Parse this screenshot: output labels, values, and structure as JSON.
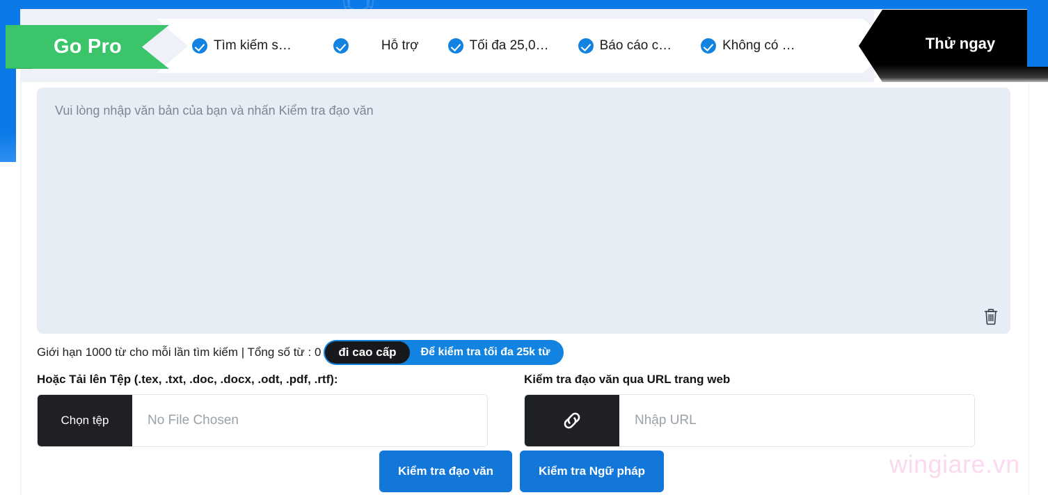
{
  "banner": {
    "gopro_label": "Go Pro",
    "cta_label": "Thử ngay",
    "features": [
      {
        "label": "Tìm kiếm s…",
        "icon": "check-circle-icon"
      },
      {
        "label": "Hỗ trợ",
        "icon": "check-circle-icon"
      },
      {
        "label": "Tối đa 25,0…",
        "icon": "check-circle-icon"
      },
      {
        "label": "Báo cáo c…",
        "icon": "check-circle-icon"
      },
      {
        "label": "Không có …",
        "icon": "check-circle-icon"
      }
    ],
    "colors": {
      "band": "#0b7ae8",
      "gopro": "#3cc46b",
      "cta": "#000000",
      "check": "#1283e0"
    }
  },
  "editor": {
    "placeholder": "Vui lòng nhập văn bản của bạn và nhấn Kiểm tra đạo văn",
    "value": "",
    "clear_icon": "trash-icon",
    "background": "#e7edf5"
  },
  "counter": {
    "text": "Giới hạn 1000 từ cho mỗi lần tìm kiếm | Tổng số từ : 0",
    "premium_badge": "đi cao cấp",
    "premium_text": "Để kiểm tra tối đa 25k từ",
    "badge_color": "#1283e0"
  },
  "upload": {
    "label": "Hoặc Tải lên Tệp (.tex, .txt, .doc, .docx, .odt, .pdf, .rtf):",
    "button_label": "Chọn tệp",
    "file_placeholder": "No File Chosen",
    "file_value": ""
  },
  "url": {
    "label": "Kiểm tra đạo văn qua URL trang web",
    "icon": "link-icon",
    "placeholder": "Nhập URL",
    "value": ""
  },
  "actions": {
    "plagiarism_label": "Kiểm tra đạo văn",
    "grammar_label": "Kiểm tra Ngữ pháp"
  },
  "watermark": {
    "text": "wingiare.vn",
    "color": "#fbd9ee"
  }
}
